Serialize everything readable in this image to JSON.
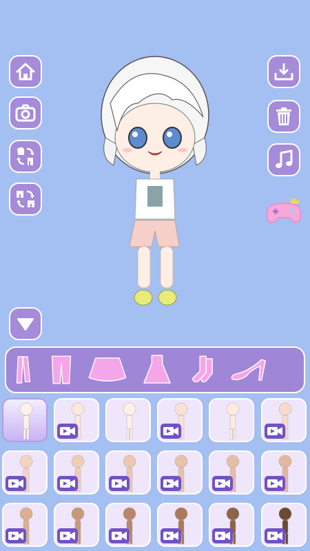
{
  "left_buttons": [
    {
      "name": "home-button",
      "icon": "home-icon"
    },
    {
      "name": "camera-button",
      "icon": "camera-icon"
    },
    {
      "name": "swap-top-button",
      "icon": "swap-top-icon"
    },
    {
      "name": "swap-bottom-button",
      "icon": "swap-bottom-icon"
    }
  ],
  "right_buttons": [
    {
      "name": "download-button",
      "icon": "download-icon"
    },
    {
      "name": "delete-button",
      "icon": "trash-icon"
    },
    {
      "name": "music-button",
      "icon": "music-note-icon"
    },
    {
      "name": "game-button",
      "icon": "gamepad-icon"
    }
  ],
  "collapse_button": {
    "icon": "triangle-down-icon"
  },
  "categories": [
    {
      "id": "jacket",
      "icon": "jacket-icon"
    },
    {
      "id": "pants",
      "icon": "pants-icon"
    },
    {
      "id": "skirt",
      "icon": "skirt-icon"
    },
    {
      "id": "dress",
      "icon": "dress-icon"
    },
    {
      "id": "socks",
      "icon": "socks-icon"
    },
    {
      "id": "shoes",
      "icon": "high-heel-icon"
    }
  ],
  "body_options": {
    "rows": [
      [
        {
          "skin": "#fdf1ea",
          "video": false,
          "selected": true
        },
        {
          "skin": "#fbe7dc",
          "video": true
        },
        {
          "skin": "#fdf0e8",
          "video": false
        },
        {
          "skin": "#f9e2d5",
          "video": true
        },
        {
          "skin": "#fcebe1",
          "video": false
        },
        {
          "skin": "#f7dbcd",
          "video": true
        }
      ],
      [
        {
          "skin": "#f5d3c3",
          "video": true
        },
        {
          "skin": "#f1cdb7",
          "video": true
        },
        {
          "skin": "#edc7b1",
          "video": true
        },
        {
          "skin": "#e9c1aa",
          "video": true
        },
        {
          "skin": "#e6bea6",
          "video": true
        },
        {
          "skin": "#e2b79d",
          "video": true
        }
      ],
      [
        {
          "skin": "#dcae94",
          "video": true
        },
        {
          "skin": "#c9987b",
          "video": true
        },
        {
          "skin": "#b98669",
          "video": true
        },
        {
          "skin": "#a97a5c",
          "video": true
        },
        {
          "skin": "#8e6548",
          "video": true
        },
        {
          "skin": "#6b4a32",
          "video": true
        }
      ]
    ]
  },
  "colors": {
    "background": "#a4bff2",
    "button": "#a58bd9",
    "category_bar": "#9f86d6",
    "category_icon": "#f5a6e8",
    "video_badge": "#7152c4"
  }
}
